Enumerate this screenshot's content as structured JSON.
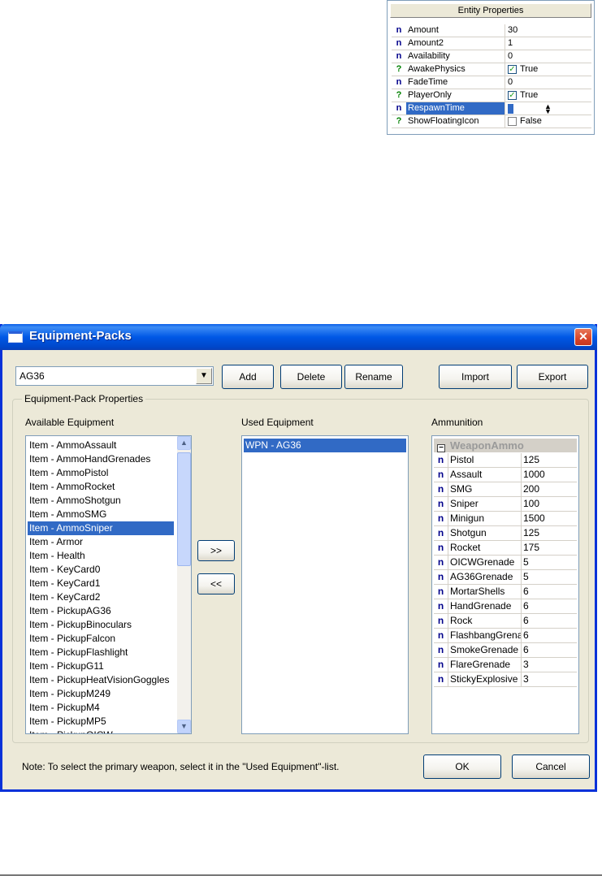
{
  "entity_panel": {
    "title": "Entity Properties",
    "rows": [
      {
        "type": "n",
        "name": "Amount",
        "value": "30"
      },
      {
        "type": "n",
        "name": "Amount2",
        "value": "1"
      },
      {
        "type": "n",
        "name": "Availability",
        "value": "0"
      },
      {
        "type": "?",
        "name": "AwakePhysics",
        "value": "True",
        "checkbox": true,
        "checked": true
      },
      {
        "type": "n",
        "name": "FadeTime",
        "value": "0"
      },
      {
        "type": "?",
        "name": "PlayerOnly",
        "value": "True",
        "checkbox": true,
        "checked": true
      },
      {
        "type": "n",
        "name": "RespawnTime",
        "value": "",
        "selected": true,
        "editing": true
      },
      {
        "type": "?",
        "name": "ShowFloatingIcon",
        "value": "False",
        "checkbox": true,
        "checked": false
      }
    ]
  },
  "dialog": {
    "title": "Equipment-Packs",
    "close_glyph": "✕",
    "pack_select": {
      "value": "AG36",
      "arrow": "▼"
    },
    "buttons": {
      "add": "Add",
      "delete": "Delete",
      "rename": "Rename",
      "import": "Import",
      "export": "Export",
      "move_right": ">>",
      "move_left": "<<",
      "ok": "OK",
      "cancel": "Cancel"
    },
    "group_label": "Equipment-Pack Properties",
    "available": {
      "label": "Available Equipment",
      "selected_index": 6,
      "items": [
        "Item - AmmoAssault",
        "Item - AmmoHandGrenades",
        "Item - AmmoPistol",
        "Item - AmmoRocket",
        "Item - AmmoShotgun",
        "Item - AmmoSMG",
        "Item - AmmoSniper",
        "Item - Armor",
        "Item - Health",
        "Item - KeyCard0",
        "Item - KeyCard1",
        "Item - KeyCard2",
        "Item - PickupAG36",
        "Item - PickupBinoculars",
        "Item - PickupFalcon",
        "Item - PickupFlashlight",
        "Item - PickupG11",
        "Item - PickupHeatVisionGoggles",
        "Item - PickupM249",
        "Item - PickupM4",
        "Item - PickupMP5",
        "Item - PickupOICW"
      ]
    },
    "used": {
      "label": "Used Equipment",
      "items": [
        "WPN - AG36"
      ]
    },
    "ammunition": {
      "label": "Ammunition",
      "group": "WeaponAmmo",
      "rows": [
        {
          "name": "Pistol",
          "value": "125"
        },
        {
          "name": "Assault",
          "value": "1000"
        },
        {
          "name": "SMG",
          "value": "200"
        },
        {
          "name": "Sniper",
          "value": "100"
        },
        {
          "name": "Minigun",
          "value": "1500"
        },
        {
          "name": "Shotgun",
          "value": "125"
        },
        {
          "name": "Rocket",
          "value": "175"
        },
        {
          "name": "OICWGrenade",
          "value": "5"
        },
        {
          "name": "AG36Grenade",
          "value": "5"
        },
        {
          "name": "MortarShells",
          "value": "6"
        },
        {
          "name": "HandGrenade",
          "value": "6"
        },
        {
          "name": "Rock",
          "value": "6"
        },
        {
          "name": "FlashbangGrenade",
          "value": "6"
        },
        {
          "name": "SmokeGrenade",
          "value": "6"
        },
        {
          "name": "FlareGrenade",
          "value": "3"
        },
        {
          "name": "StickyExplosive",
          "value": "3"
        }
      ]
    },
    "note": "Note: To select the primary weapon, select it in the \"Used Equipment\"-list."
  }
}
